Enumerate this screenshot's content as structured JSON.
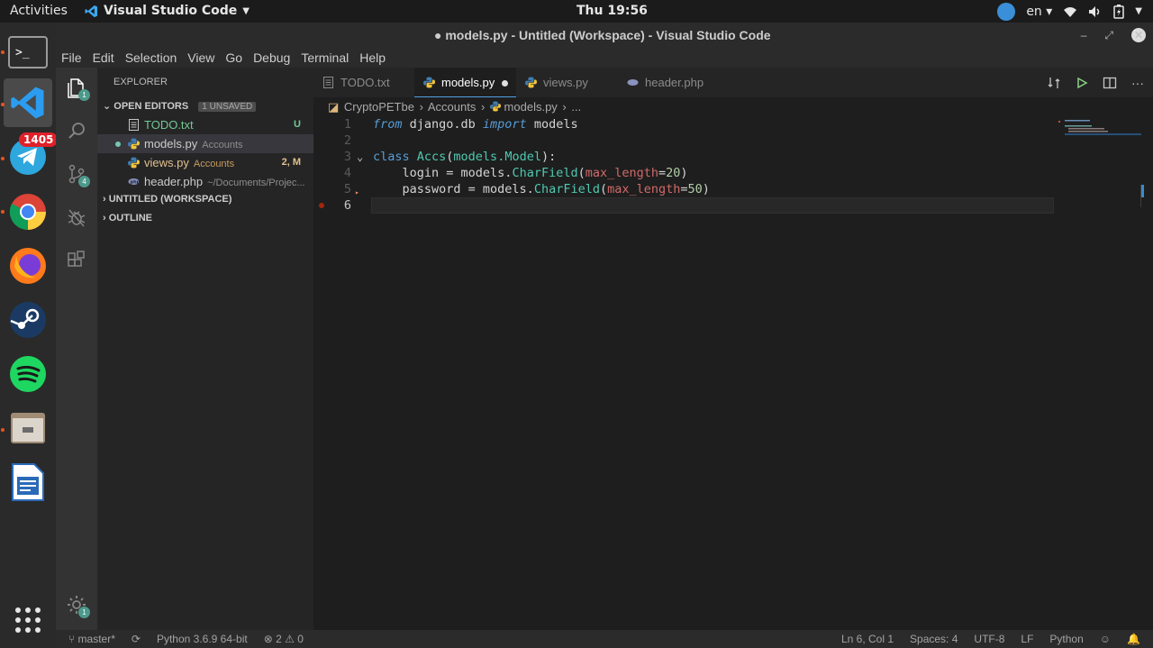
{
  "topbar": {
    "activities": "Activities",
    "app_name": "Visual Studio Code",
    "clock": "Thu 19:56",
    "lang": "en"
  },
  "dock": {
    "telegram_badge": "1405"
  },
  "window": {
    "title": "● models.py - Untitled (Workspace) - Visual Studio Code"
  },
  "menu": [
    "File",
    "Edit",
    "Selection",
    "View",
    "Go",
    "Debug",
    "Terminal",
    "Help"
  ],
  "activity": {
    "explorer_badge": "1",
    "scm_badge": "4",
    "settings_badge": "1"
  },
  "sidebar": {
    "title": "EXPLORER",
    "open_editors": "OPEN EDITORS",
    "unsaved": "1 UNSAVED",
    "files": [
      {
        "name": "TODO.txt",
        "desc": "",
        "status": "U"
      },
      {
        "name": "models.py",
        "desc": "Accounts",
        "status": ""
      },
      {
        "name": "views.py",
        "desc": "Accounts",
        "status": "2, M"
      },
      {
        "name": "header.php",
        "desc": "~/Documents/Projec...",
        "status": ""
      }
    ],
    "workspace": "UNTITLED (WORKSPACE)",
    "outline": "OUTLINE"
  },
  "tabs": [
    {
      "label": "TODO.txt"
    },
    {
      "label": "models.py"
    },
    {
      "label": "views.py"
    },
    {
      "label": "header.php"
    }
  ],
  "breadcrumb": {
    "root": "CryptoPETbe",
    "folder": "Accounts",
    "file": "models.py",
    "more": "..."
  },
  "code": {
    "line_numbers": [
      "1",
      "2",
      "3",
      "4",
      "5",
      "6"
    ],
    "l1_from": "from",
    "l1_mod": " django.db ",
    "l1_import": "import",
    "l1_rest": " models",
    "l3_class": "class",
    "l3_name": " Accs",
    "l3_open": "(",
    "l3_base": "models.Model",
    "l3_close": "):",
    "l4_a": "    login = models.",
    "l4_fn": "CharField",
    "l4_p": "(",
    "l4_kw": "max_length",
    "l4_eq": "=",
    "l4_num": "20",
    "l4_e": ")",
    "l5_a": "    password = models.",
    "l5_fn": "CharField",
    "l5_p": "(",
    "l5_kw": "max_length",
    "l5_eq": "=",
    "l5_num": "50",
    "l5_e": ")"
  },
  "status": {
    "branch": "master*",
    "python": "Python 3.6.9 64-bit",
    "errors": "2",
    "warnings": "0",
    "position": "Ln 6, Col 1",
    "spaces": "Spaces: 4",
    "encoding": "UTF-8",
    "eol": "LF",
    "language": "Python"
  },
  "colors": {
    "accent": "#51a1e6",
    "modified": "#e2c08d",
    "untracked": "#73c991",
    "error": "#f48771"
  }
}
